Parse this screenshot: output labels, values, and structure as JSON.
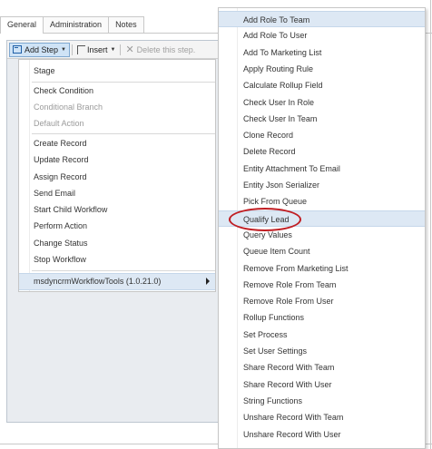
{
  "tabs": [
    "General",
    "Administration",
    "Notes"
  ],
  "toolbar": {
    "add_step": "Add Step",
    "insert": "Insert",
    "delete": "Delete this step."
  },
  "left_menu": {
    "items": [
      {
        "label": "Stage",
        "disabled": false
      },
      {
        "label": "Check Condition",
        "disabled": false
      },
      {
        "label": "Conditional Branch",
        "disabled": true
      },
      {
        "label": "Default Action",
        "disabled": true
      },
      {
        "label": "Create Record",
        "disabled": false
      },
      {
        "label": "Update Record",
        "disabled": false
      },
      {
        "label": "Assign Record",
        "disabled": false
      },
      {
        "label": "Send Email",
        "disabled": false
      },
      {
        "label": "Start Child Workflow",
        "disabled": false
      },
      {
        "label": "Perform Action",
        "disabled": false
      },
      {
        "label": "Change Status",
        "disabled": false
      },
      {
        "label": "Stop Workflow",
        "disabled": false
      },
      {
        "label": "msdyncrmWorkflowTools (1.0.21.0)",
        "disabled": false
      }
    ]
  },
  "right_menu": {
    "items": [
      "Add Role To Team",
      "Add Role To User",
      "Add To Marketing List",
      "Apply Routing Rule",
      "Calculate Rollup Field",
      "Check User In Role",
      "Check User In Team",
      "Clone Record",
      "Delete Record",
      "Entity Attachment To Email",
      "Entity Json Serializer",
      "Pick From Queue",
      "Qualify Lead",
      "Query Values",
      "Queue Item Count",
      "Remove From Marketing List",
      "Remove Role From Team",
      "Remove Role From User",
      "Rollup Functions",
      "Set Process",
      "Set User Settings",
      "Share Record With Team",
      "Share Record With User",
      "String Functions",
      "Unshare Record With Team",
      "Unshare Record With User"
    ],
    "highlighted": [
      "Add Role To Team",
      "Qualify Lead"
    ]
  },
  "colors": {
    "highlight": "#dde8f4",
    "annotation": "#c01d22"
  }
}
